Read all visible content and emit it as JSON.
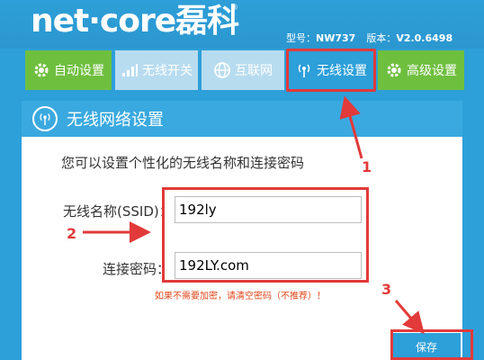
{
  "brand": {
    "logo": "net·core磊科",
    "reg": "®"
  },
  "device": {
    "model_label": "型号：",
    "model": "NW737",
    "version_label": "版本：",
    "version": "V2.0.6498"
  },
  "nav": {
    "tabs": [
      {
        "label": "自动设置",
        "icon": "gear-icon"
      },
      {
        "label": "无线开关",
        "icon": "signal-bars-icon"
      },
      {
        "label": "互联网",
        "icon": "globe-icon"
      },
      {
        "label": "无线设置",
        "icon": "wireless-icon"
      },
      {
        "label": "高级设置",
        "icon": "gear-icon"
      }
    ]
  },
  "panel": {
    "title": "无线网络设置",
    "intro": "您可以设置个性化的无线名称和连接密码",
    "ssid_label": "无线名称(SSID)：",
    "ssid_value": "192ly",
    "password_label": "连接密码：",
    "password_value": "192LY.com",
    "hint": "如果不需要加密，请清空密码（不推荐）！",
    "save_label": "保存"
  },
  "annotations": {
    "step1": "1",
    "step2": "2",
    "step3": "3"
  },
  "colors": {
    "header_blue": "#2d9fd9",
    "green_tab": "#6fbf3f",
    "light_tab": "#b8dcef",
    "highlight_red": "#e23a3a",
    "hint_orange": "#e0471a"
  }
}
